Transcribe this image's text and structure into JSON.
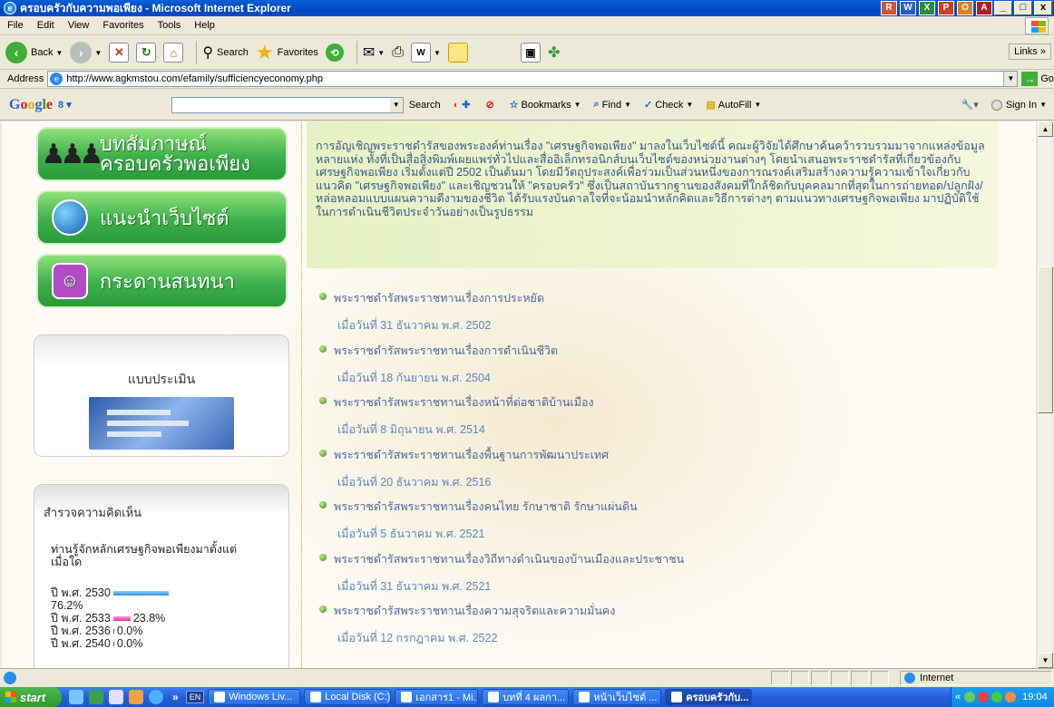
{
  "window": {
    "title": "ครอบครัวกับความพอเพียง - Microsoft Internet Explorer",
    "controls": [
      "_",
      "□",
      "x"
    ]
  },
  "menu": [
    "File",
    "Edit",
    "View",
    "Favorites",
    "Tools",
    "Help"
  ],
  "toolbar": {
    "back_label": "Back",
    "search_label": "Search",
    "favorites_label": "Favorites",
    "links_label": "Links"
  },
  "address": {
    "label": "Address",
    "url": "http://www.agkmstou.com/efamily/sufficiencyeconomy.php",
    "go_label": "Go"
  },
  "google": {
    "search_label": "Search",
    "bookmarks_label": "Bookmarks",
    "find_label": "Find",
    "check_label": "Check",
    "autofill_label": "AutoFill",
    "signin_label": "Sign In"
  },
  "sidebar": {
    "nav": [
      {
        "line1": "บทสัมภาษณ์",
        "line2": "ครอบครัวพอเพียง"
      },
      {
        "label": "แนะนำเว็บไซต์"
      },
      {
        "label": "กระดานสนทนา"
      }
    ],
    "evaluation_title": "แบบประเมิน",
    "poll": {
      "title": "สำรวจความคิดเห็น",
      "question": "ท่านรู้จักหลักเศรษฐกิจพอเพียงมาตั้งแต่เมื่อใด",
      "results": [
        {
          "label": "ปี พ.ศ. 2530",
          "percent": "76.2%",
          "value": 76.2,
          "color": "blue"
        },
        {
          "label": "ปี พ.ศ. 2533",
          "percent": "23.8%",
          "value": 23.8,
          "color": "pink"
        },
        {
          "label": "ปี พ.ศ. 2536",
          "percent": "0.0%",
          "value": 0.0,
          "color": "none"
        },
        {
          "label": "ปี พ.ศ. 2540",
          "percent": "0.0%",
          "value": 0.0,
          "color": "none"
        }
      ]
    }
  },
  "intro": {
    "text": "การอัญเชิญพระราชดำรัสของพระองค์ท่านเรื่อง \"เศรษฐกิจพอเพียง\" มาลงในเว็บไซต์นี้ คณะผู้วิจัยได้ศึกษาค้นคว้ารวบรวมมาจากแหล่งข้อมูลหลายแห่ง ทั้งที่เป็นสื่อสิ่งพิมพ์เผยแพร่ทั่วไปและสื่ออิเล็กทรอนิกส์บนเว็บไซต์ของหน่วยงานต่างๆ โดยนำเสนอพระราชดำรัสที่เกี่ยวข้องกับเศรษฐกิจพอเพียง เริ่มตั้งแต่ปี 2502 เป็นต้นมา โดยมีวัตถุประสงค์เพื่อร่วมเป็นส่วนหนึ่งของการณรงค์เสริมสร้างความรู้ความเข้าใจเกี่ยวกับแนวคิด \"เศรษฐกิจพอเพียง\" และเชิญชวนให้ \"ครอบครัว\" ซึ่งเป็นสถาบันรากฐานของสังคมที่ใกล้ชิดกับบุคคลมากที่สุดในการถ่ายทอด/ปลูกฝัง/หล่อหลอมแบบแผนความดีงามของชีวิต ได้รับแรงบันดาลใจที่จะน้อมนำหลักคิดและวิธีการต่างๆ ตามแนวทางเศรษฐกิจพอเพียง มาปฏิบัติใช้ในการดำเนินชีวิตประจำวันอย่างเป็นรูปธรรม"
  },
  "speeches": [
    {
      "title": "พระราชดำรัสพระราชทานเรื่องการประหยัด",
      "date": "เมื่อวันที่ 31 ธันวาคม พ.ศ. 2502"
    },
    {
      "title": "พระราชดำรัสพระราชทานเรื่องการดำเนินชีวิต",
      "date": "เมื่อวันที่ 18 กันยายน พ.ศ. 2504"
    },
    {
      "title": "พระราชดำรัสพระราชทานเรื่องหน้าที่ต่อชาติบ้านเมือง",
      "date": "เมื่อวันที่ 8 มิถุนายน พ.ศ. 2514"
    },
    {
      "title": "พระราชดำรัสพระราชทานเรื่องพื้นฐานการพัฒนาประเทศ",
      "date": "เมื่อวันที่ 20 ธันวาคม พ.ศ. 2516"
    },
    {
      "title": "พระราชดำรัสพระราชทานเรื่องคนไทย รักษาชาติ รักษาแผ่นดิน",
      "date": "เมื่อวันที่ 5 ธันวาคม พ.ศ. 2521"
    },
    {
      "title": "พระราชดำรัสพระราชทานเรื่องวิถีทางดำเนินของบ้านเมืองและประชาชน",
      "date": "เมื่อวันที่ 31 ธันวาคม พ.ศ. 2521"
    },
    {
      "title": "พระราชดำรัสพระราชทานเรื่องความสุจริตและความมั่นคง",
      "date": "เมื่อวันที่ 12 กรกฎาคม พ.ศ. 2522"
    }
  ],
  "status": {
    "zone": "Internet"
  },
  "taskbar": {
    "start": "start",
    "lang": "EN",
    "buttons": [
      {
        "label": "Windows Liv...",
        "active": false
      },
      {
        "label": "Local Disk (C:)",
        "active": false
      },
      {
        "label": "เอกสาร1 - Mi...",
        "active": false
      },
      {
        "label": "บทที่ 4 ผลกา...",
        "active": false
      },
      {
        "label": "หน้าเว็บไซต์ ...",
        "active": false
      },
      {
        "label": "ครอบครัวกับ...",
        "active": true
      }
    ],
    "clock": "19:04"
  },
  "colors": {
    "title_bar": "#0346c2",
    "nav_green": "#3db04a",
    "speech_title": "#4a6a9a",
    "speech_date": "#5a8abf",
    "intro_text": "#3a5a8a"
  }
}
